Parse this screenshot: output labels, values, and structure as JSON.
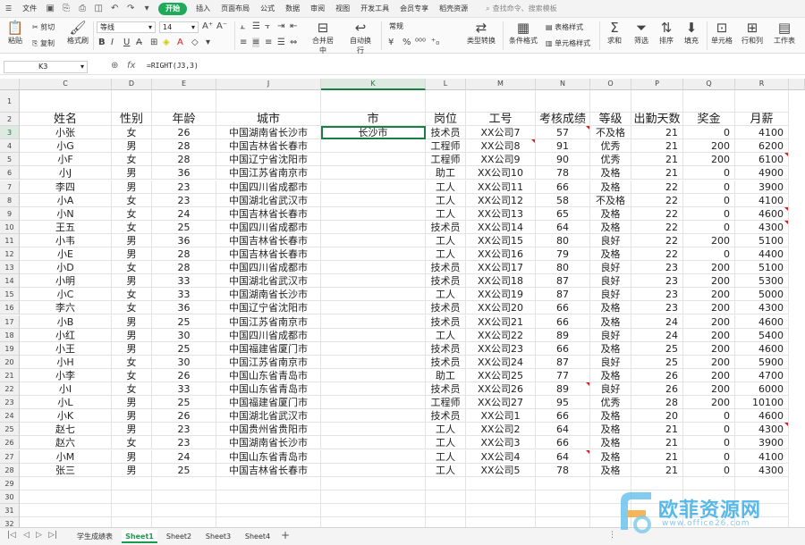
{
  "menu": {
    "file": "文件",
    "tabs": [
      "开始",
      "插入",
      "页面布局",
      "公式",
      "数据",
      "审阅",
      "视图",
      "开发工具",
      "会员专享",
      "稻壳资源"
    ],
    "active_tab": "开始",
    "search": "查找命令、搜索模板"
  },
  "ribbon": {
    "paste": "粘贴",
    "cut": "剪切",
    "copy": "复制",
    "format_painter": "格式刷",
    "font_name": "等线",
    "font_size": "14",
    "merge_center": "合并居中",
    "wrap": "自动换行",
    "number_format": "常规",
    "type_convert": "类型转换",
    "cond_format": "条件格式",
    "table_style": "表格样式",
    "cell_style": "单元格样式",
    "sum": "求和",
    "filter": "筛选",
    "sort": "排序",
    "fill": "填充",
    "cell": "单元格",
    "row_col": "行和列",
    "worksheet": "工作表"
  },
  "formula_bar": {
    "name_box": "K3",
    "fx": "fx",
    "formula": "=RIGHT(J3,3)"
  },
  "columns": [
    "C",
    "D",
    "E",
    "J",
    "K",
    "L",
    "M",
    "N",
    "O",
    "P",
    "Q",
    "R"
  ],
  "selected_column": "K",
  "selected_row": 3,
  "header_row": [
    "姓名",
    "性别",
    "年龄",
    "城市",
    "市",
    "岗位",
    "工号",
    "考核成绩",
    "等级",
    "出勤天数",
    "奖金",
    "月薪"
  ],
  "rows": [
    [
      "小张",
      "女",
      "26",
      "中国湖南省长沙市",
      "长沙市",
      "技术员",
      "XX公司7",
      "57",
      "不及格",
      "21",
      "0",
      "4100"
    ],
    [
      "小G",
      "男",
      "28",
      "中国吉林省长春市",
      "",
      "工程师",
      "XX公司8",
      "91",
      "优秀",
      "21",
      "200",
      "6200"
    ],
    [
      "小F",
      "女",
      "28",
      "中国辽宁省沈阳市",
      "",
      "工程师",
      "XX公司9",
      "90",
      "优秀",
      "21",
      "200",
      "6100"
    ],
    [
      "小J",
      "男",
      "36",
      "中国江苏省南京市",
      "",
      "助工",
      "XX公司10",
      "78",
      "及格",
      "21",
      "0",
      "4900"
    ],
    [
      "李四",
      "男",
      "23",
      "中国四川省成都市",
      "",
      "工人",
      "XX公司11",
      "66",
      "及格",
      "22",
      "0",
      "3900"
    ],
    [
      "小A",
      "女",
      "23",
      "中国湖北省武汉市",
      "",
      "工人",
      "XX公司12",
      "58",
      "不及格",
      "22",
      "0",
      "4100"
    ],
    [
      "小N",
      "女",
      "24",
      "中国吉林省长春市",
      "",
      "工人",
      "XX公司13",
      "65",
      "及格",
      "22",
      "0",
      "4600"
    ],
    [
      "王五",
      "女",
      "25",
      "中国四川省成都市",
      "",
      "技术员",
      "XX公司14",
      "64",
      "及格",
      "22",
      "0",
      "4300"
    ],
    [
      "小韦",
      "男",
      "36",
      "中国吉林省长春市",
      "",
      "工人",
      "XX公司15",
      "80",
      "良好",
      "22",
      "200",
      "5100"
    ],
    [
      "小E",
      "男",
      "28",
      "中国吉林省长春市",
      "",
      "工人",
      "XX公司16",
      "79",
      "及格",
      "22",
      "0",
      "4400"
    ],
    [
      "小D",
      "女",
      "28",
      "中国四川省成都市",
      "",
      "技术员",
      "XX公司17",
      "80",
      "良好",
      "23",
      "200",
      "5100"
    ],
    [
      "小明",
      "男",
      "33",
      "中国湖北省武汉市",
      "",
      "技术员",
      "XX公司18",
      "87",
      "良好",
      "23",
      "200",
      "5300"
    ],
    [
      "小C",
      "女",
      "33",
      "中国湖南省长沙市",
      "",
      "工人",
      "XX公司19",
      "87",
      "良好",
      "23",
      "200",
      "5000"
    ],
    [
      "李六",
      "女",
      "36",
      "中国辽宁省沈阳市",
      "",
      "技术员",
      "XX公司20",
      "66",
      "及格",
      "23",
      "200",
      "4300"
    ],
    [
      "小B",
      "男",
      "25",
      "中国江苏省南京市",
      "",
      "技术员",
      "XX公司21",
      "66",
      "及格",
      "24",
      "200",
      "4600"
    ],
    [
      "小红",
      "男",
      "30",
      "中国四川省成都市",
      "",
      "工人",
      "XX公司22",
      "89",
      "良好",
      "24",
      "200",
      "5400"
    ],
    [
      "小王",
      "男",
      "25",
      "中国福建省厦门市",
      "",
      "技术员",
      "XX公司23",
      "66",
      "及格",
      "25",
      "200",
      "4600"
    ],
    [
      "小H",
      "女",
      "30",
      "中国江苏省南京市",
      "",
      "技术员",
      "XX公司24",
      "87",
      "良好",
      "25",
      "200",
      "5900"
    ],
    [
      "小李",
      "女",
      "26",
      "中国山东省青岛市",
      "",
      "助工",
      "XX公司25",
      "77",
      "及格",
      "26",
      "200",
      "4700"
    ],
    [
      "小I",
      "女",
      "33",
      "中国山东省青岛市",
      "",
      "技术员",
      "XX公司26",
      "89",
      "良好",
      "26",
      "200",
      "6000"
    ],
    [
      "小L",
      "男",
      "25",
      "中国福建省厦门市",
      "",
      "工程师",
      "XX公司27",
      "95",
      "优秀",
      "28",
      "200",
      "10100"
    ],
    [
      "小K",
      "男",
      "26",
      "中国湖北省武汉市",
      "",
      "技术员",
      "XX公司1",
      "66",
      "及格",
      "20",
      "0",
      "4600"
    ],
    [
      "赵七",
      "男",
      "23",
      "中国贵州省贵阳市",
      "",
      "工人",
      "XX公司2",
      "64",
      "及格",
      "21",
      "0",
      "4300"
    ],
    [
      "赵六",
      "女",
      "23",
      "中国湖南省长沙市",
      "",
      "工人",
      "XX公司3",
      "66",
      "及格",
      "21",
      "0",
      "3900"
    ],
    [
      "小M",
      "男",
      "24",
      "中国山东省青岛市",
      "",
      "工人",
      "XX公司4",
      "64",
      "及格",
      "21",
      "0",
      "4100"
    ],
    [
      "张三",
      "男",
      "25",
      "中国吉林省长春市",
      "",
      "工人",
      "XX公司5",
      "78",
      "及格",
      "21",
      "0",
      "4300"
    ]
  ],
  "row_numbers": [
    "1",
    "2",
    "3",
    "4",
    "5",
    "6",
    "7",
    "8",
    "9",
    "10",
    "11",
    "12",
    "13",
    "14",
    "15",
    "16",
    "17",
    "18",
    "19",
    "20",
    "21",
    "22",
    "23",
    "24",
    "25",
    "26",
    "27",
    "28",
    "29",
    "30",
    "31",
    "32"
  ],
  "sheets": [
    "学生成绩表",
    "Sheet1",
    "Sheet2",
    "Sheet3",
    "Sheet4"
  ],
  "active_sheet": "Sheet1",
  "watermark": {
    "text": "欧菲资源网",
    "url": "www.office26.com"
  },
  "colors": {
    "accent": "#1a9a4e",
    "comment_marker": "#d32020"
  }
}
